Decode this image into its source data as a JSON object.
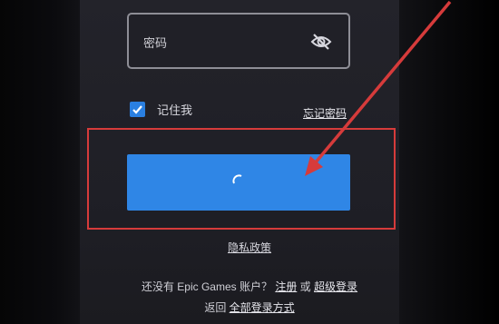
{
  "password": {
    "label": "密码",
    "icon": "eye-off-icon"
  },
  "remember": {
    "label": "记住我",
    "checked": true,
    "accent": "#2a7fe0"
  },
  "forgot_password": "忘记密码",
  "login_button": {
    "state": "loading",
    "color": "#2f86e6"
  },
  "privacy_link": "隐私政策",
  "signup": {
    "prefix": "还没有 Epic Games 账户？",
    "signup_link": "注册",
    "or": "或",
    "other_link": "超级登录"
  },
  "return_row": {
    "prefix": "返回",
    "all_methods_link": "全部登录方式"
  },
  "annotation": {
    "color": "#d63b3b"
  }
}
